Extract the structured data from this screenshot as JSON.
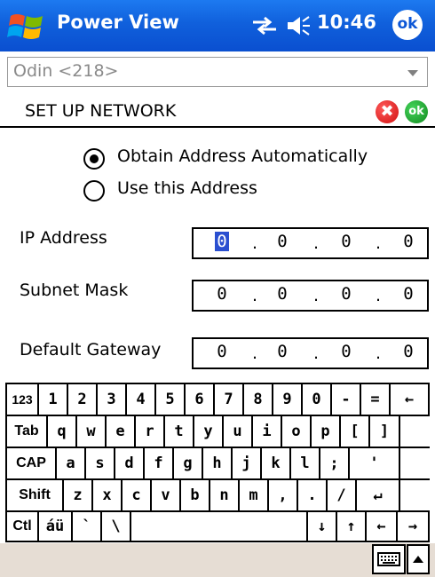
{
  "title_bar": {
    "app_title": "Power View",
    "clock": "10:46",
    "ok_label": "ok"
  },
  "device_select": {
    "value": "Odin <218>"
  },
  "header": {
    "title": "SET UP NETWORK",
    "cancel_symbol": "✖",
    "ok_label": "ok"
  },
  "address_mode": {
    "options": [
      {
        "label": "Obtain Address Automatically",
        "selected": true
      },
      {
        "label": "Use this Address",
        "selected": false
      }
    ]
  },
  "fields": {
    "ip_address": {
      "label": "IP Address",
      "octets": [
        "0",
        "0",
        "0",
        "0"
      ]
    },
    "subnet_mask": {
      "label": "Subnet Mask",
      "octets": [
        "0",
        "0",
        "0",
        "0"
      ]
    },
    "default_gateway": {
      "label": "Default Gateway",
      "octets": [
        "0",
        "0",
        "0",
        "0"
      ]
    }
  },
  "keyboard": {
    "rows": [
      [
        "123",
        "1",
        "2",
        "3",
        "4",
        "5",
        "6",
        "7",
        "8",
        "9",
        "0",
        "-",
        "=",
        "←"
      ],
      [
        "Tab",
        "q",
        "w",
        "e",
        "r",
        "t",
        "y",
        "u",
        "i",
        "o",
        "p",
        "[",
        "]"
      ],
      [
        "CAP",
        "a",
        "s",
        "d",
        "f",
        "g",
        "h",
        "j",
        "k",
        "l",
        ";",
        "'"
      ],
      [
        "Shift",
        "z",
        "x",
        "c",
        "v",
        "b",
        "n",
        "m",
        ",",
        ".",
        "/",
        "↵"
      ],
      [
        "Ctl",
        "áü",
        "`",
        "\\",
        "",
        "↓",
        "↑",
        "←",
        "→"
      ]
    ]
  }
}
